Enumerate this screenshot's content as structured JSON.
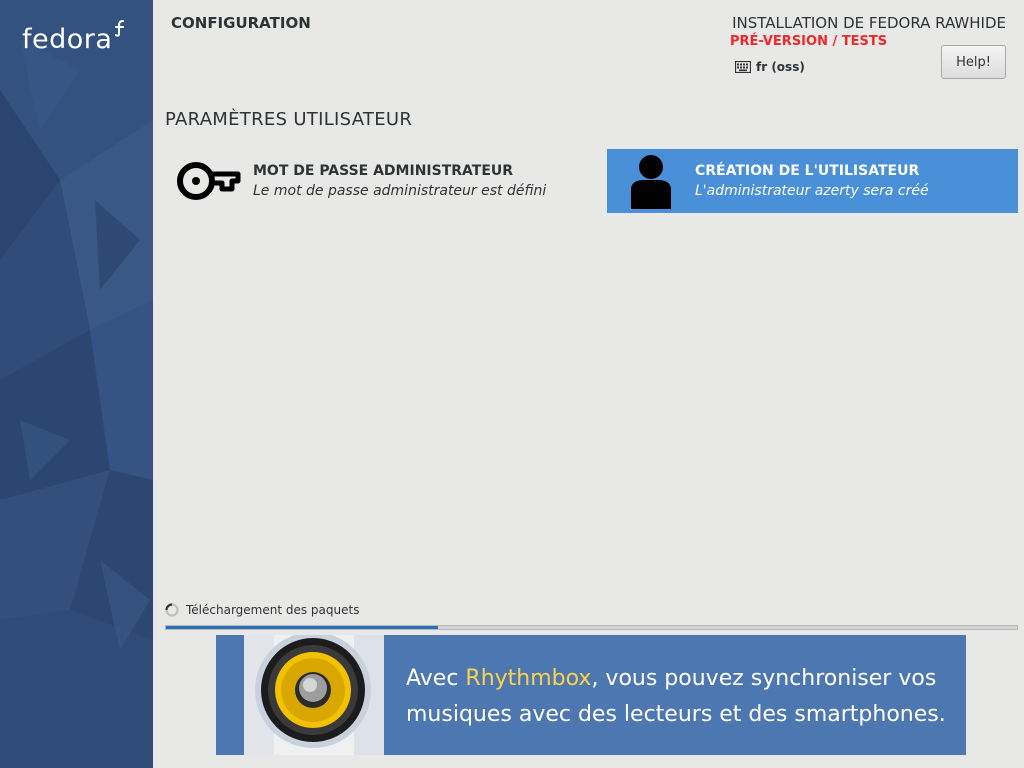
{
  "sidebar": {
    "logo_text": "fedora",
    "background_color": "#2e4a76"
  },
  "header": {
    "spoke_title": "CONFIGURATION",
    "product_title": "INSTALLATION DE FEDORA RAWHIDE",
    "prerelease": "PRÉ-VERSION / TESTS",
    "keyboard_layout": "fr (oss)",
    "help_label": "Help!"
  },
  "content": {
    "section_title": "PARAMÈTRES UTILISATEUR",
    "spokes": [
      {
        "name": "MOT DE PASSE ADMINISTRATEUR",
        "status": "Le mot de passe administrateur est défini",
        "icon": "key-icon",
        "selected": false
      },
      {
        "name": "CRÉATION DE L'UTILISATEUR",
        "status": "L'administrateur azerty sera créé",
        "icon": "user-icon",
        "selected": true
      }
    ]
  },
  "progress": {
    "label": "Téléchargement des paquets",
    "fraction": 0.32
  },
  "banner": {
    "text_before": "Avec ",
    "highlight": "Rhythmbox",
    "text_after": ", vous pouvez synchroniser vos musiques avec des lecteurs et des smartphones.",
    "icon": "speaker-icon"
  },
  "colors": {
    "accent": "#4a90d9",
    "prerelease_red": "#ef2929",
    "banner_bg": "#4d77b1",
    "highlight_yellow": "#fcd24c"
  }
}
